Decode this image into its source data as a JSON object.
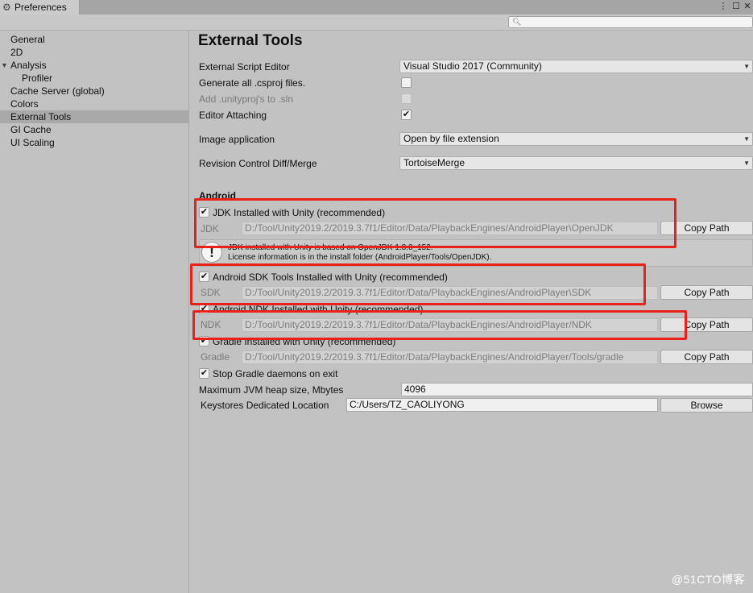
{
  "window": {
    "tab_title": "Preferences",
    "tab_icon": "gear-icon",
    "menu_glyph": "⋮",
    "maximize_glyph": "☐",
    "close_glyph": "✕"
  },
  "search": {
    "placeholder": "",
    "icon": "search-icon"
  },
  "sidebar": {
    "items": [
      {
        "label": "General"
      },
      {
        "label": "2D"
      },
      {
        "label": "Analysis"
      },
      {
        "label": "Profiler"
      },
      {
        "label": "Cache Server (global)"
      },
      {
        "label": "Colors"
      },
      {
        "label": "External Tools",
        "selected": true
      },
      {
        "label": "GI Cache"
      },
      {
        "label": "UI Scaling"
      }
    ]
  },
  "main": {
    "title": "External Tools",
    "script_editor": {
      "label": "External Script Editor",
      "value": "Visual Studio 2017 (Community)"
    },
    "generate_csproj": {
      "label": "Generate all .csproj files.",
      "checked": false
    },
    "add_unityproj": {
      "label": "Add .unityproj's to .sln",
      "checked": false,
      "disabled": true
    },
    "editor_attaching": {
      "label": "Editor Attaching",
      "checked": true
    },
    "image_application": {
      "label": "Image application",
      "value": "Open by file extension"
    },
    "revision_control": {
      "label": "Revision Control Diff/Merge",
      "value": "TortoiseMerge"
    },
    "android": {
      "header": "Android",
      "jdk": {
        "toggle_label": "JDK Installed with Unity (recommended)",
        "field_label": "JDK",
        "path": "D:/Tool/Unity2019.2/2019.3.7f1/Editor/Data/PlaybackEngines/AndroidPlayer\\OpenJDK",
        "button": "Copy Path",
        "info_line1": "JDK installed with Unity is based on OpenJDK 1.8.0_152.",
        "info_line2": "License information is in the install folder (AndroidPlayer/Tools/OpenJDK).",
        "info_glyph": "!"
      },
      "sdk": {
        "toggle_label": "Android SDK Tools Installed with Unity (recommended)",
        "field_label": "SDK",
        "path": "D:/Tool/Unity2019.2/2019.3.7f1/Editor/Data/PlaybackEngines/AndroidPlayer\\SDK",
        "button": "Copy Path"
      },
      "ndk": {
        "toggle_label": "Android NDK Installed with Unity (recommended)",
        "field_label": "NDK",
        "path": "D:/Tool/Unity2019.2/2019.3.7f1/Editor/Data/PlaybackEngines/AndroidPlayer/NDK",
        "button": "Copy Path"
      },
      "gradle": {
        "toggle_label": "Gradle Installed with Unity (recommended)",
        "field_label": "Gradle",
        "path": "D:/Tool/Unity2019.2/2019.3.7f1/Editor/Data/PlaybackEngines/AndroidPlayer/Tools/gradle",
        "button": "Copy Path"
      },
      "stop_gradle": {
        "label": "Stop Gradle daemons on exit",
        "checked": true
      },
      "jvm_heap": {
        "label": "Maximum JVM heap size, Mbytes",
        "value": "4096"
      },
      "keystores": {
        "label": "Keystores Dedicated Location",
        "value": "C:/Users/TZ_CAOLIYONG",
        "button": "Browse"
      }
    }
  },
  "check_glyph": "✔",
  "dropdown_glyph": "▼",
  "collapse_glyph": "▼",
  "annotation_color": "#e8221b",
  "watermark": "@51CTO博客"
}
